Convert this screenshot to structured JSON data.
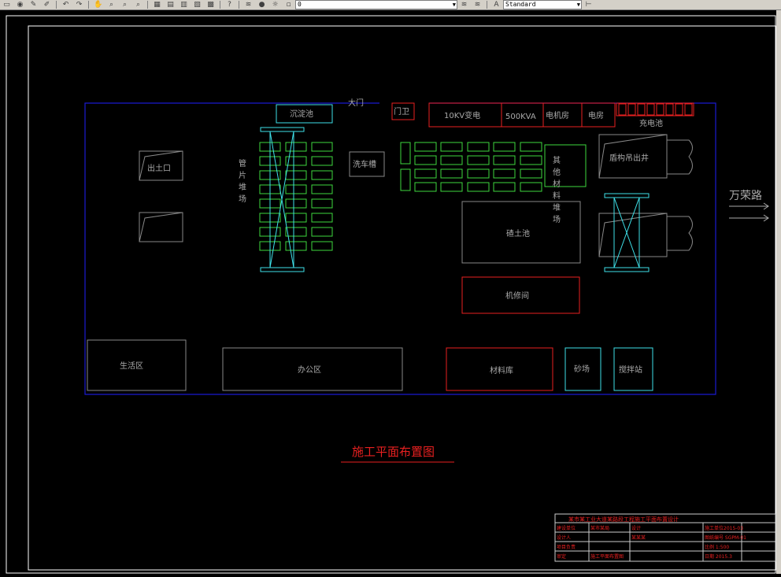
{
  "toolbar": {
    "icons": [
      "open-icon",
      "print-icon",
      "pencil-icon",
      "undo-icon",
      "redo-icon",
      "pan-icon",
      "zoom-realtime-icon",
      "zoom-window-icon",
      "zoom-previous-icon",
      "properties-icon",
      "design-center-icon",
      "tool-palettes-icon",
      "sheet-set-icon",
      "markup-icon",
      "calculator-icon",
      "help-icon",
      "layer-manager-icon",
      "lightbulb-icon",
      "sun-icon",
      "layer-color-icon",
      "layer-lock-icon",
      "layer-state-icon",
      "layer-previous-icon",
      "text-style-icon"
    ],
    "layer_value": "0",
    "text_style_value": "Standard"
  },
  "drawing": {
    "colors": {
      "site_boundary": "#1a1ad0",
      "red": "#e82020",
      "green": "#3ed83e",
      "cyan": "#3ee0e8",
      "gray": "#8a8a8a",
      "white": "#ffffff"
    },
    "labels": {
      "main_gate": "大门",
      "guard": "门卫",
      "transformer": "10KV变电",
      "kva": "500KVA",
      "generator": "电机房",
      "power_room": "电房",
      "charging": "充电池",
      "sedimentation": "沉淀池",
      "exit": "出土口",
      "segment_storage": [
        "管",
        "片",
        "堆",
        "场"
      ],
      "car_wash": "洗车槽",
      "other_materials": [
        "其",
        "他",
        "材",
        "料",
        "堆",
        "场"
      ],
      "muck_pit": "碴土池",
      "shield_shaft": "盾构吊出井",
      "road": "万荣路",
      "repair_shop": "机修间",
      "living_area": "生活区",
      "office_area": "办公区",
      "material_store": "材料库",
      "sand_yard": "砂场",
      "mixing_station": "搅拌站",
      "drawing_title": "施工平面布置图"
    },
    "title_block": {
      "header": "某市某工业大道某路段工程施工平面布置设计",
      "rows": [
        [
          "建设单位",
          "某市某局",
          "设计",
          "施工单位2015-03"
        ],
        [
          "设计人",
          "",
          "某某某",
          "图纸编号 SGPM-01"
        ],
        [
          "项目负责",
          "",
          "",
          "比例 1:500"
        ],
        [
          "审定",
          "施工平面布置图",
          "",
          "日期 2015.3"
        ]
      ]
    }
  }
}
